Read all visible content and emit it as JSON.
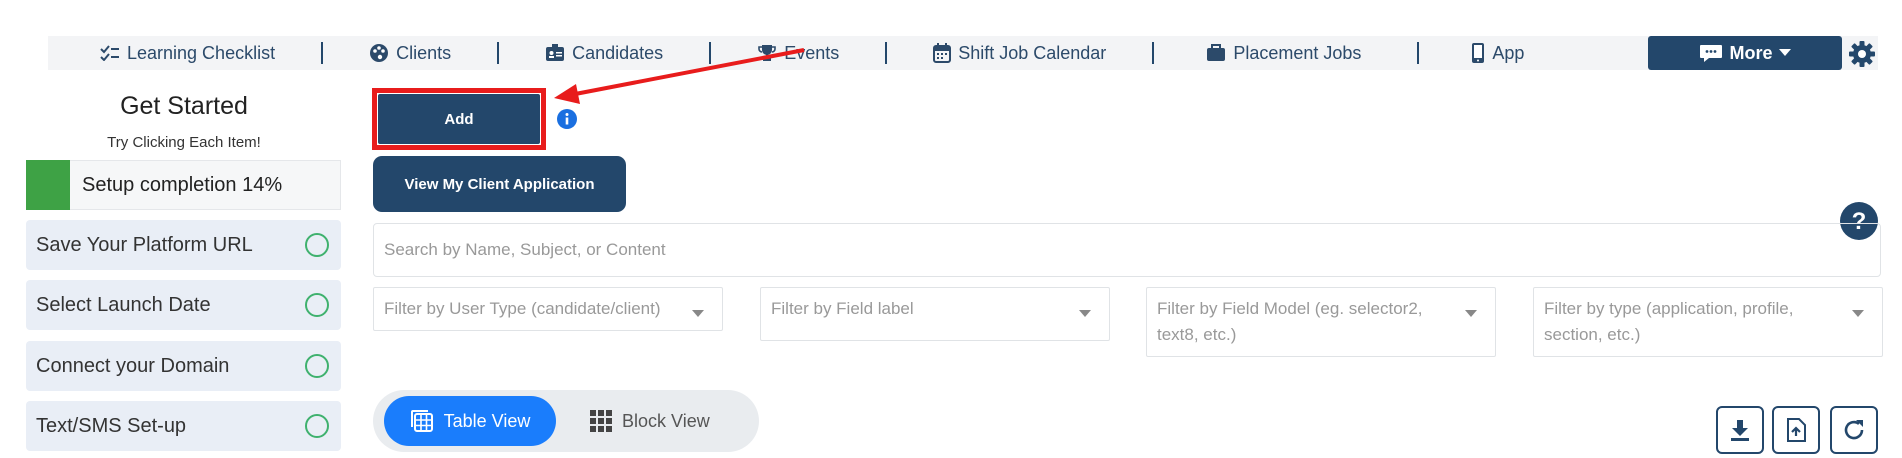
{
  "nav": {
    "items": [
      {
        "label": "Learning Checklist",
        "icon": "checklist-icon"
      },
      {
        "label": "Clients",
        "icon": "palette-icon"
      },
      {
        "label": "Candidates",
        "icon": "id-badge-icon"
      },
      {
        "label": "Events",
        "icon": "trophy-icon"
      },
      {
        "label": "Shift Job Calendar",
        "icon": "calendar-icon"
      },
      {
        "label": "Placement Jobs",
        "icon": "briefcase-icon"
      },
      {
        "label": "App",
        "icon": "mobile-icon"
      }
    ],
    "more_label": "More"
  },
  "sidebar": {
    "title": "Get Started",
    "subtitle": "Try Clicking Each Item!",
    "setup_label": "Setup completion 14%",
    "setup_progress": 0.14,
    "tasks": [
      {
        "label": "Save Your Platform URL"
      },
      {
        "label": "Select Launch Date"
      },
      {
        "label": "Connect your Domain"
      },
      {
        "label": "Text/SMS Set-up"
      }
    ]
  },
  "main": {
    "add_label": "Add",
    "view_app_label": "View My Client Application",
    "search_placeholder": "Search by Name, Subject, or Content",
    "filters": [
      "Filter by User Type (candidate/client)",
      "Filter by Field label",
      "Filter by Field Model (eg. selector2, text8, etc.)",
      "Filter by type (application, profile, section, etc.)"
    ],
    "table_view_label": "Table View",
    "block_view_label": "Block View"
  },
  "colors": {
    "navy": "#23476b",
    "highlight": "#e81c1c",
    "primary_blue": "#1a7dfc",
    "progress_green": "#3ea245",
    "task_circle": "#3fb16e"
  }
}
